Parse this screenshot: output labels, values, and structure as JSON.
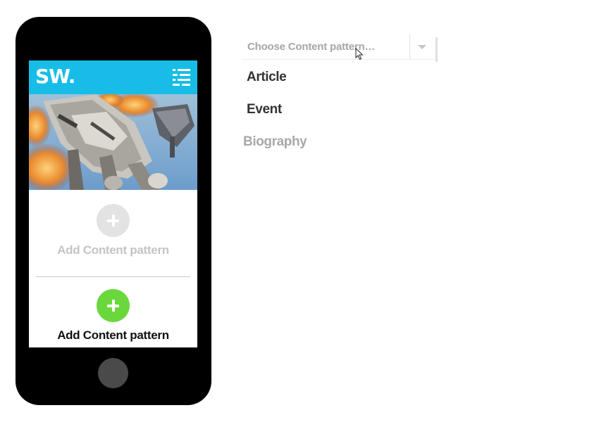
{
  "phone": {
    "header": {
      "logo_text": "SW.",
      "menu_icon": "hamburger-menu-icon",
      "brand_color": "#17bde6"
    },
    "hero": {
      "icon": "star-wars-at-at-image"
    },
    "slots": [
      {
        "label": "Add Content pattern",
        "state": "inactive",
        "circle_color": "#e3e3e3",
        "icon": "plus-icon"
      },
      {
        "label": "Add Content pattern",
        "state": "active",
        "circle_color": "#6ad83d",
        "icon": "plus-icon"
      }
    ],
    "home_button_icon": "home-button"
  },
  "dropdown": {
    "placeholder": "Choose Content pattern…",
    "arrow_icon": "chevron-down-icon",
    "options": [
      {
        "label": "Article",
        "state": "normal"
      },
      {
        "label": "Event",
        "state": "normal"
      },
      {
        "label": "Biography",
        "state": "disabled"
      }
    ]
  },
  "cursor_icon": "mouse-pointer-icon"
}
